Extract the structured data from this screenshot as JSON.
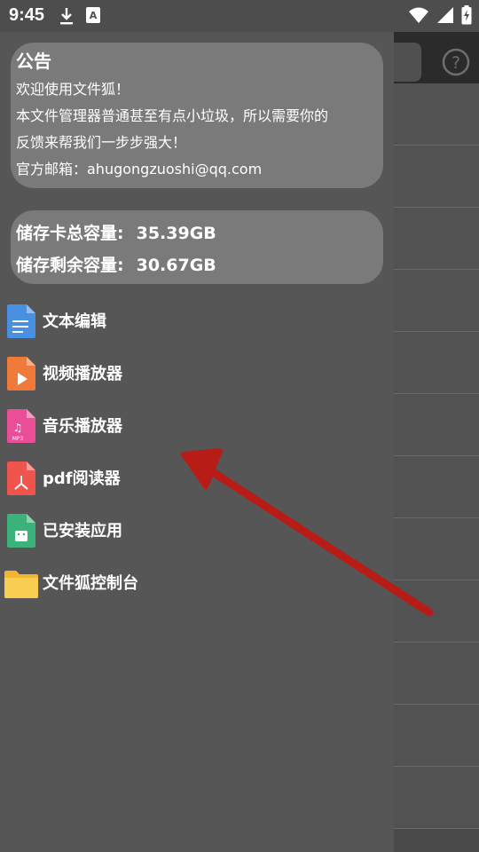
{
  "status_bar": {
    "time": "9:45",
    "icons_left": [
      "download-icon",
      "a-letter-icon"
    ],
    "icons_right": [
      "wifi-icon",
      "cellular-signal-icon",
      "battery-charging-icon"
    ]
  },
  "notice": {
    "title": "公告",
    "lines": [
      "欢迎使用文件狐！",
      "本文件管理器普通甚至有点小垃圾，所以需要你的",
      "反馈来帮我们一步步强大！",
      "官方邮箱：ahugongzuoshi@qq.com"
    ]
  },
  "storage": {
    "total_label": "储存卡总容量:",
    "total_value": "35.39GB",
    "free_label": "储存剩余容量:",
    "free_value": "30.67GB"
  },
  "menu": [
    {
      "label": "文本编辑",
      "icon": "text-document-icon",
      "color": "#4a90e2"
    },
    {
      "label": "视频播放器",
      "icon": "video-file-icon",
      "color": "#f07a3a"
    },
    {
      "label": "音乐播放器",
      "icon": "mp3-file-icon",
      "color": "#e94e96"
    },
    {
      "label": "pdf阅读器",
      "icon": "pdf-file-icon",
      "color": "#f0554d"
    },
    {
      "label": "已安装应用",
      "icon": "apk-file-icon",
      "color": "#3ab27a"
    },
    {
      "label": "文件狐控制台",
      "icon": "folder-icon",
      "color": "#f7c948"
    }
  ],
  "background_app": {
    "help_icon": "help-icon"
  },
  "colors": {
    "drawer_bg": "#565656",
    "card_bg": "#7a7a7a",
    "arrow": "#b81c17"
  }
}
